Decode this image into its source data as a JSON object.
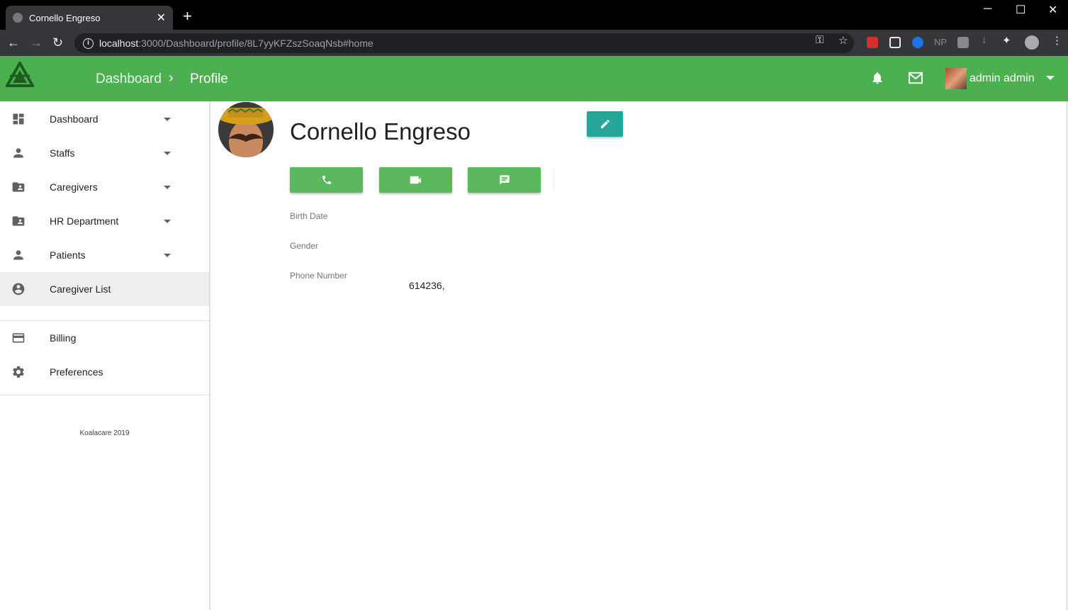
{
  "browser": {
    "tab_title": "Cornello Engreso",
    "url_host": "localhost",
    "url_rest": ":3000/Dashboard/profile/8L7yyKFZszSoaqNsb#home"
  },
  "header": {
    "breadcrumb": [
      "Dashboard",
      "Profile"
    ],
    "username": "admin admin",
    "brand_color": "#4caf50"
  },
  "sidebar": {
    "items": [
      {
        "label": "Dashboard",
        "icon": "dashboard-icon",
        "expandable": true
      },
      {
        "label": "Staffs",
        "icon": "person-icon",
        "expandable": true
      },
      {
        "label": "Caregivers",
        "icon": "contact-folder-icon",
        "expandable": true
      },
      {
        "label": "HR Department",
        "icon": "contact-folder-icon",
        "expandable": true
      },
      {
        "label": "Patients",
        "icon": "person-icon",
        "expandable": true
      },
      {
        "label": "Caregiver List",
        "icon": "account-circle-icon",
        "expandable": false,
        "active": true
      }
    ],
    "secondary": [
      {
        "label": "Billing",
        "icon": "credit-card-icon"
      },
      {
        "label": "Preferences",
        "icon": "gear-icon"
      }
    ],
    "footer": "Koalacare 2019"
  },
  "profile": {
    "name": "Cornello Engreso",
    "fields": [
      {
        "label": "Birth Date",
        "value": ""
      },
      {
        "label": "Gender",
        "value": ""
      },
      {
        "label": "Phone Number",
        "value": "614236,"
      }
    ],
    "actions": [
      "phone-icon",
      "video-icon",
      "message-icon"
    ],
    "edit_color": "#26a69a",
    "action_color": "#5cb85c"
  }
}
